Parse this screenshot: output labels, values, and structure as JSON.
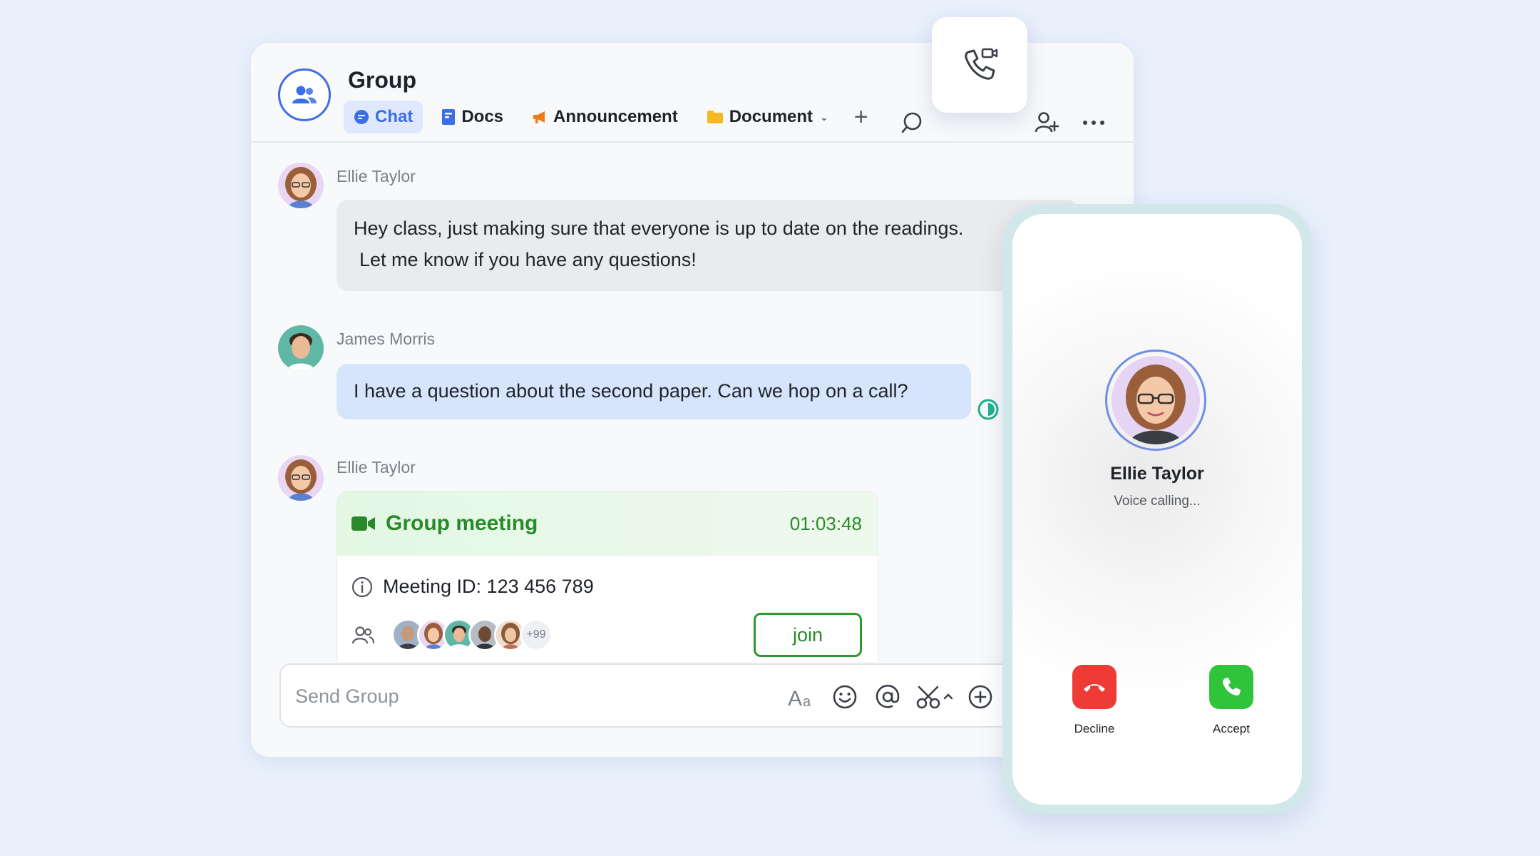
{
  "colors": {
    "page_bg": "#e9f0fc",
    "accent_blue": "#3c6ee8",
    "meeting_green": "#2a8a2a",
    "decline_red": "#ef3b36",
    "accept_green": "#2fc43c"
  },
  "header": {
    "title": "Group",
    "tabs": [
      {
        "label": "Chat",
        "icon": "chat-bubble-icon",
        "active": true
      },
      {
        "label": "Docs",
        "icon": "docs-icon"
      },
      {
        "label": "Announcement",
        "icon": "megaphone-icon"
      },
      {
        "label": "Document",
        "icon": "folder-icon"
      }
    ],
    "add_tab": "+",
    "icons": [
      "search-icon",
      "phone-video-icon",
      "add-member-icon",
      "more-icon"
    ]
  },
  "messages": [
    {
      "sender": "Ellie Taylor",
      "line1": "Hey class, just making sure that everyone is up to date on the readings.",
      "line2": "Let me know if you have any questions!"
    },
    {
      "sender": "James Morris",
      "text": "I have a question about the second paper. Can we hop on a call?"
    },
    {
      "sender": "Ellie Taylor"
    }
  ],
  "meeting": {
    "title": "Group meeting",
    "time": "01:03:48",
    "meeting_id": "Meeting ID: 123 456 789",
    "more_count": "+99",
    "join_label": "join"
  },
  "composer": {
    "placeholder": "Send Group",
    "icons": [
      "text-format-icon",
      "emoji-icon",
      "mention-icon",
      "scissors-icon",
      "plus-circle-icon"
    ]
  },
  "call": {
    "caller_name": "Ellie Taylor",
    "status": "Voice calling...",
    "decline_label": "Decline",
    "accept_label": "Accept"
  }
}
